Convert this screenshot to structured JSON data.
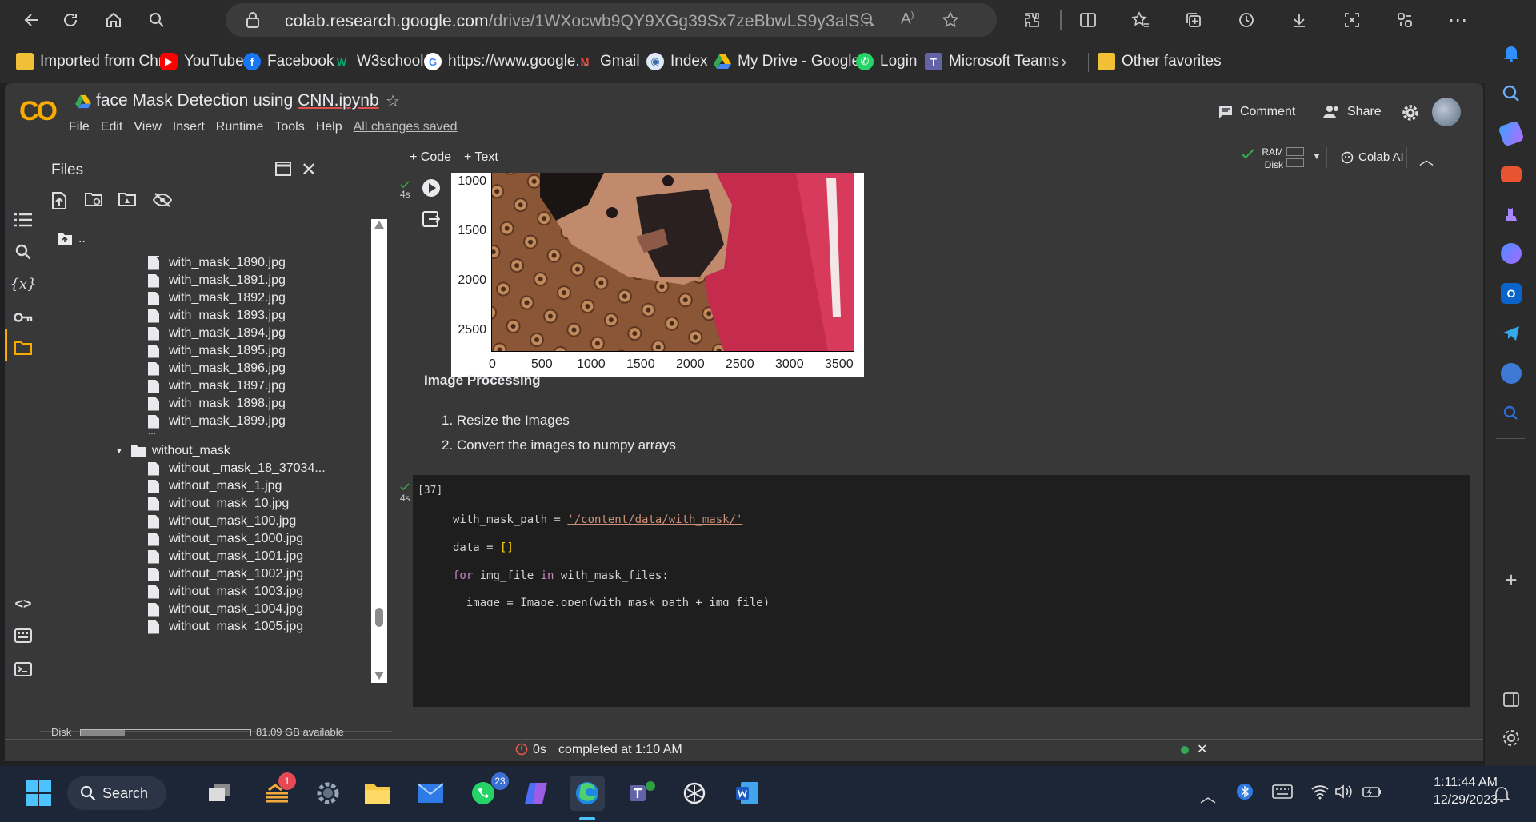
{
  "browser": {
    "url_main": "colab.research.google.com/drive/1WXocwb9QY9XGg39Sx7zeBbwLS9y3alS...",
    "favorites": [
      {
        "label": "Imported from Chr...",
        "icon": "folder-icon",
        "color": "#f2c037"
      },
      {
        "label": "YouTube",
        "icon": "youtube-icon",
        "color": "#ff0000"
      },
      {
        "label": "Facebook",
        "icon": "facebook-icon",
        "color": "#1877f2"
      },
      {
        "label": "W3school",
        "icon": "w3school-icon",
        "color": "#04aa6d"
      },
      {
        "label": "https://www.google...",
        "icon": "google-icon",
        "color": "#4285f4"
      },
      {
        "label": "Gmail",
        "icon": "gmail-icon",
        "color": "#ea4335"
      },
      {
        "label": "Index",
        "icon": "index-icon",
        "color": "#5b9bd5"
      },
      {
        "label": "My Drive - Google...",
        "icon": "google-drive-icon",
        "color": "#34a853"
      },
      {
        "label": "Login",
        "icon": "whatsapp-icon",
        "color": "#25d366"
      },
      {
        "label": "Microsoft Teams",
        "icon": "teams-icon",
        "color": "#6264a7"
      }
    ],
    "other_favorites": "Other favorites"
  },
  "colab": {
    "logo": "CO",
    "notebook_title_prefix": "face Mask Detection using ",
    "notebook_title_link": "CNN.ipynb",
    "menu": [
      "File",
      "Edit",
      "View",
      "Insert",
      "Runtime",
      "Tools",
      "Help"
    ],
    "saved_status": "All changes saved",
    "comment_label": "Comment",
    "share_label": "Share",
    "toolbar": {
      "code_label": "+ Code",
      "text_label": "+ Text",
      "ram_label": "RAM",
      "disk_label": "Disk",
      "colab_ai_label": "Colab AI"
    }
  },
  "files_panel": {
    "title": "Files",
    "parent_label": "..",
    "with_mask_files": [
      "with_mask_1890.jpg",
      "with_mask_1891.jpg",
      "with_mask_1892.jpg",
      "with_mask_1893.jpg",
      "with_mask_1894.jpg",
      "with_mask_1895.jpg",
      "with_mask_1896.jpg",
      "with_mask_1897.jpg",
      "with_mask_1898.jpg",
      "with_mask_1899.jpg"
    ],
    "ellipsis": "...",
    "folder_name": "without_mask",
    "without_mask_files": [
      "without _mask_18_37034...",
      "without_mask_1.jpg",
      "without_mask_10.jpg",
      "without_mask_100.jpg",
      "without_mask_1000.jpg",
      "without_mask_1001.jpg",
      "without_mask_1002.jpg",
      "without_mask_1003.jpg",
      "without_mask_1004.jpg",
      "without_mask_1005.jpg"
    ],
    "disk_label": "Disk",
    "disk_available": "81.09 GB available",
    "disk_used_fraction": 0.26
  },
  "output_cell": {
    "exec_time": "4s",
    "y_ticks": [
      "1000",
      "1500",
      "2000",
      "2500"
    ],
    "x_ticks": [
      "0",
      "500",
      "1000",
      "1500",
      "2000",
      "2500",
      "3000",
      "3500"
    ]
  },
  "markdown": {
    "heading": "Image Processing",
    "items": [
      "1. Resize the Images",
      "2. Convert the images to numpy arrays"
    ]
  },
  "code_cell": {
    "exec_count": "[37]",
    "exec_time": "4s",
    "line1_var": "with_mask_path = ",
    "line1_str": "'/content/data/with_mask/'",
    "line2_var": "data = ",
    "line2_br": "[]",
    "line3_kw1": "for",
    "line3_mid": " img_file ",
    "line3_kw2": "in",
    "line3_end": " with_mask_files:",
    "line4": "  image = Image.open(with_mask_path + img_file)"
  },
  "status_bar": {
    "duration": "0s",
    "completed": "completed at 1:10 AM"
  },
  "taskbar": {
    "search_label": "Search",
    "reminders_badge": "1",
    "whatsapp_badge": "23",
    "time": "1:11:44 AM",
    "date": "12/29/2023"
  }
}
